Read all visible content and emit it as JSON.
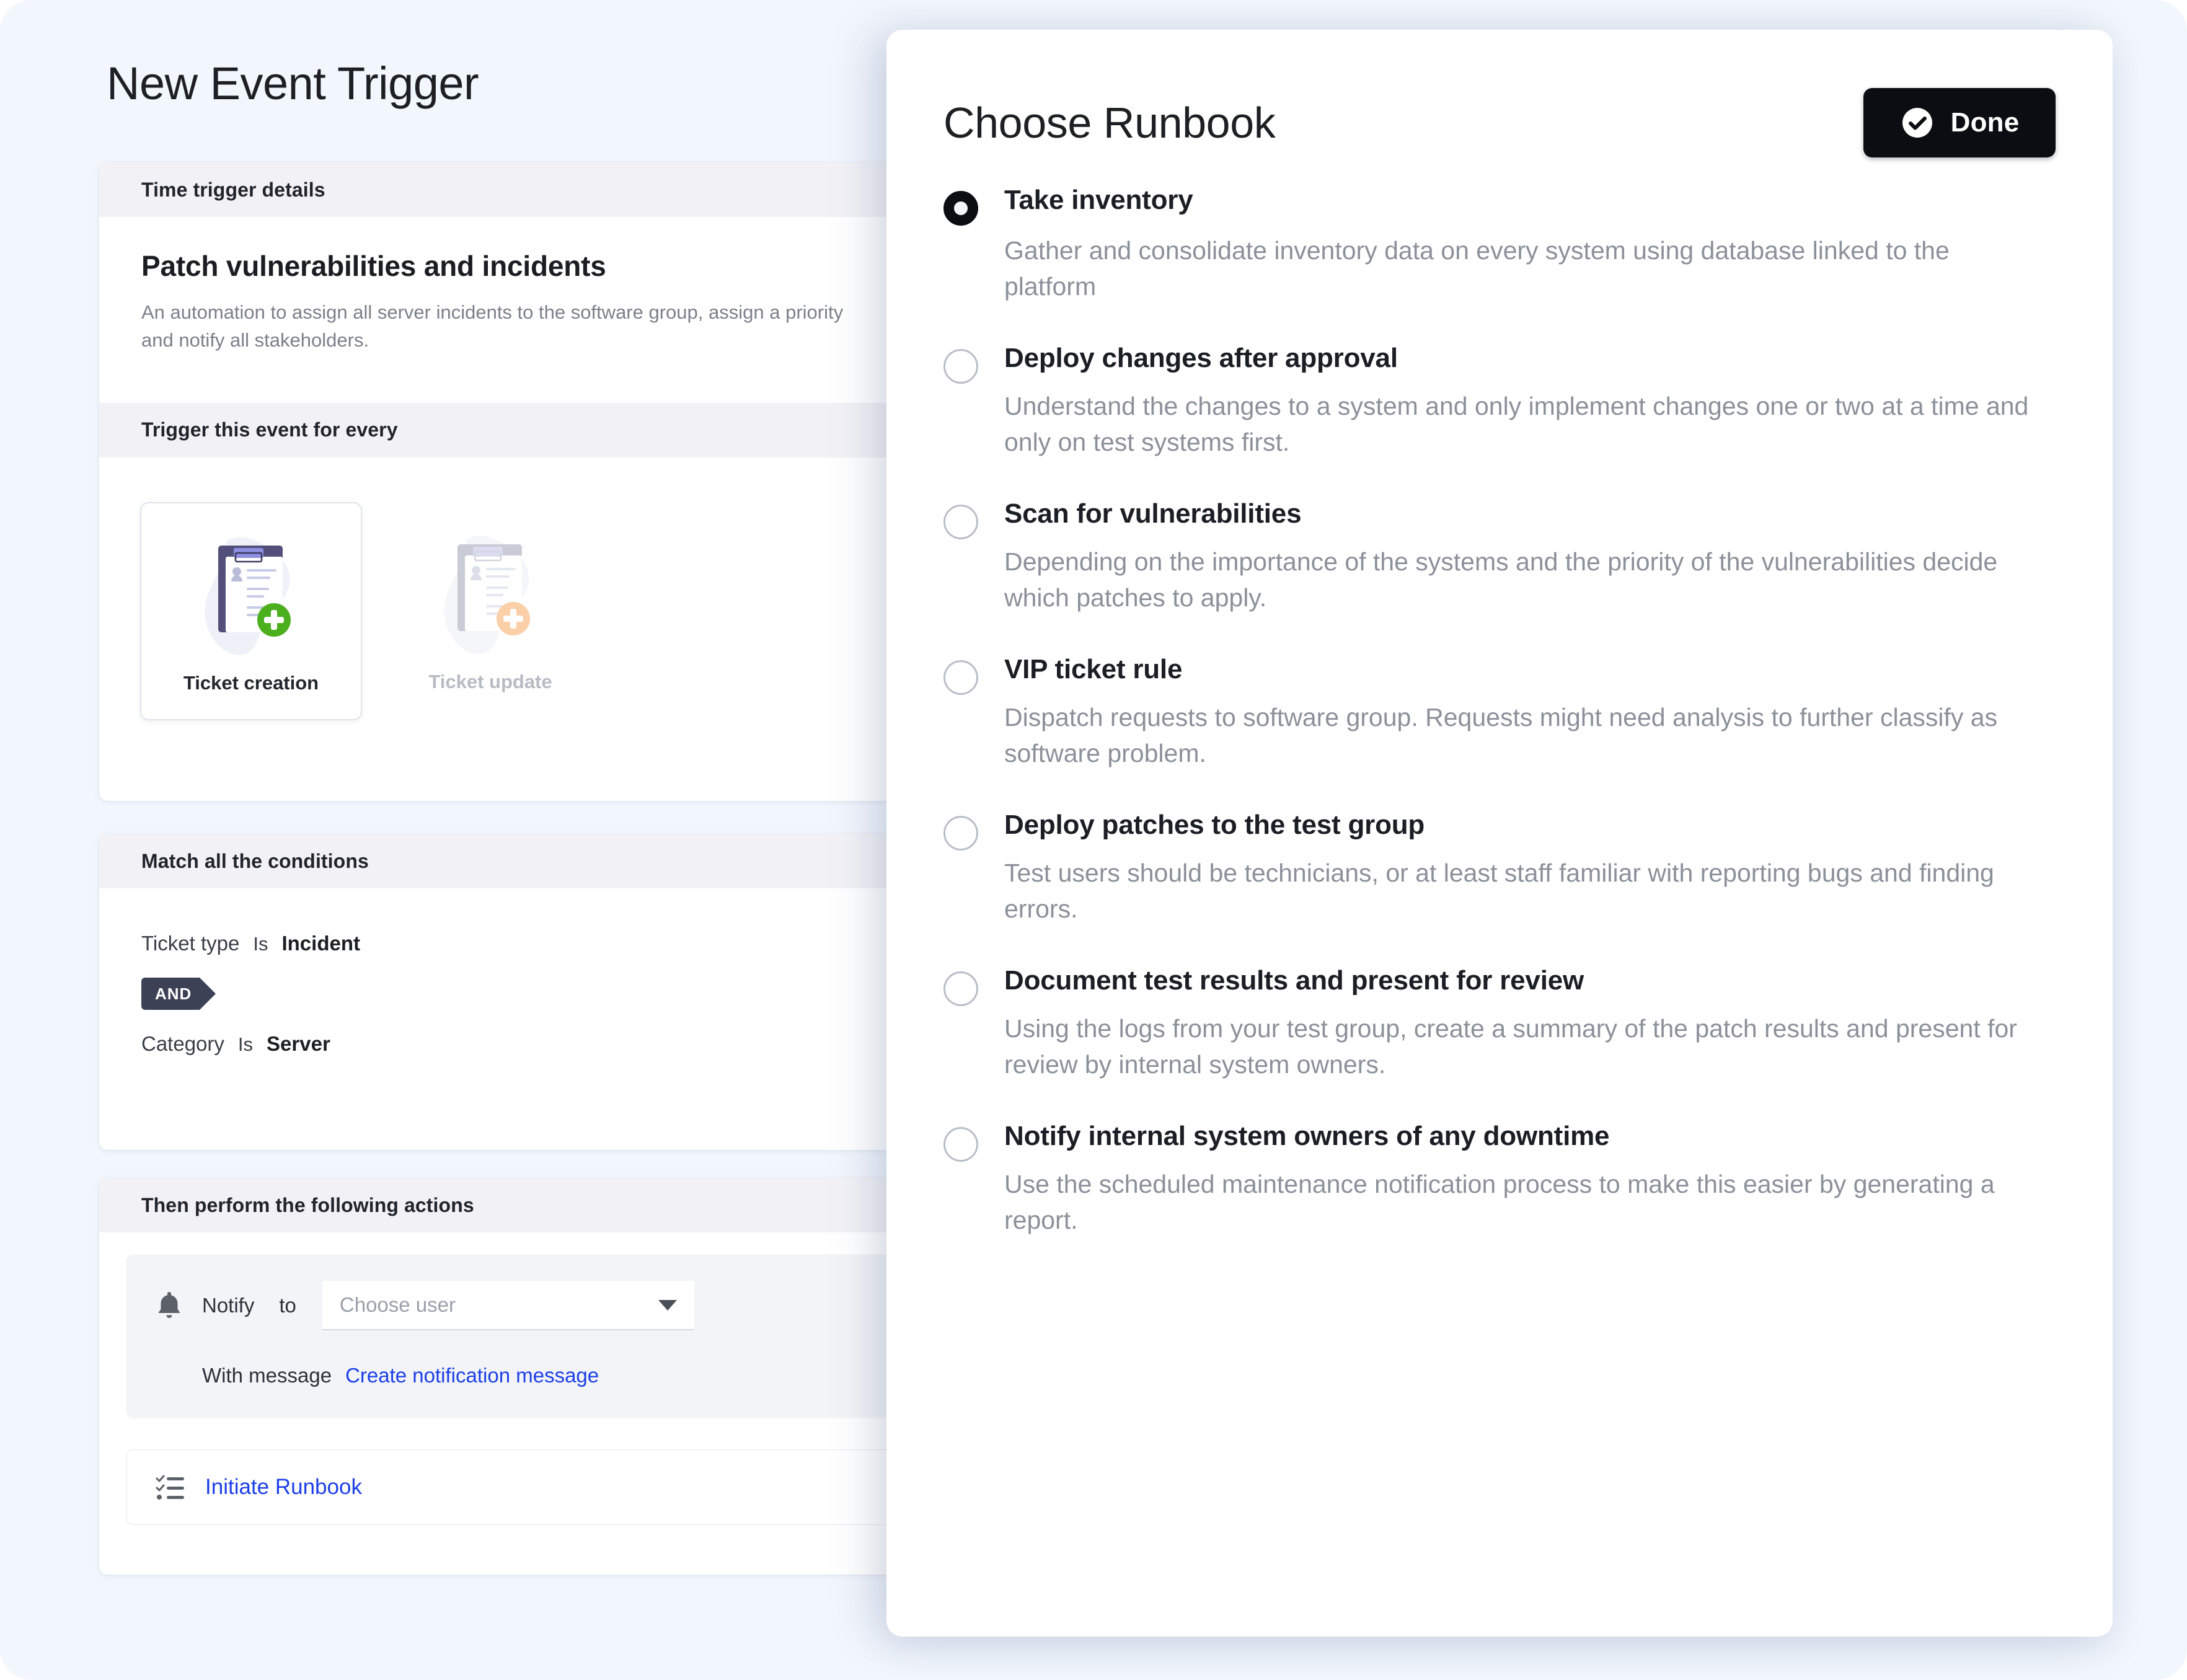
{
  "page": {
    "title": "New Event Trigger",
    "sections": {
      "time_trigger": {
        "banner": "Time trigger details",
        "title": "Patch vulnerabilities and incidents",
        "description": "An automation to assign all server incidents to the software group, assign a priority and notify all stakeholders.",
        "trigger_banner": "Trigger this event for every",
        "tiles": [
          {
            "label": "Ticket creation",
            "icon": "clipboard-plus-green-icon",
            "selected": true
          },
          {
            "label": "Ticket update",
            "icon": "clipboard-plus-orange-icon",
            "selected": false
          }
        ]
      },
      "conditions": {
        "banner": "Match all the conditions",
        "rows": [
          {
            "field": "Ticket type",
            "operator": "Is",
            "value": "Incident"
          },
          {
            "field": "Category",
            "operator": "Is",
            "value": "Server"
          }
        ],
        "joiner": "AND"
      },
      "actions": {
        "banner": "Then perform the following actions",
        "notify": {
          "icon": "bell-icon",
          "label": "Notify",
          "preposition": "to",
          "select_placeholder": "Choose user",
          "select_value": "",
          "message_label": "With message",
          "message_link": "Create notification message"
        },
        "runbook": {
          "icon": "checklist-icon",
          "link": "Initiate Runbook"
        }
      }
    }
  },
  "modal": {
    "title": "Choose Runbook",
    "done_button": {
      "label": "Done",
      "icon": "check-circle-icon"
    },
    "options": [
      {
        "title": "Take inventory",
        "description": "Gather and consolidate inventory data on every system using database linked to the platform",
        "selected": true
      },
      {
        "title": "Deploy changes after approval",
        "description": "Understand the changes to a system and only implement changes one or two at a time and only on test systems first.",
        "selected": false
      },
      {
        "title": "Scan for vulnerabilities",
        "description": "Depending on the importance of the systems and the priority of the vulnerabilities decide which patches to apply.",
        "selected": false
      },
      {
        "title": "VIP ticket rule",
        "description": "Dispatch requests to software group. Requests might need analysis to further classify as software problem.",
        "selected": false
      },
      {
        "title": "Deploy patches to the test group",
        "description": "Test users should be technicians, or at least staff familiar with reporting bugs and finding errors.",
        "selected": false
      },
      {
        "title": "Document test results and present for review",
        "description": "Using the logs from your test group, create a summary of the patch results and present for review by internal system owners.",
        "selected": false
      },
      {
        "title": "Notify internal system owners of any downtime",
        "description": "Use the scheduled maintenance notification process to make this easier by generating a report.",
        "selected": false
      }
    ]
  },
  "colors": {
    "background": "#f2f6fd",
    "accent_link": "#1c3fe8",
    "banner_bg": "#f2f2f6",
    "and_chip": "#3d4156",
    "done_button": "#0b0d12",
    "muted_text": "#8b9099"
  }
}
